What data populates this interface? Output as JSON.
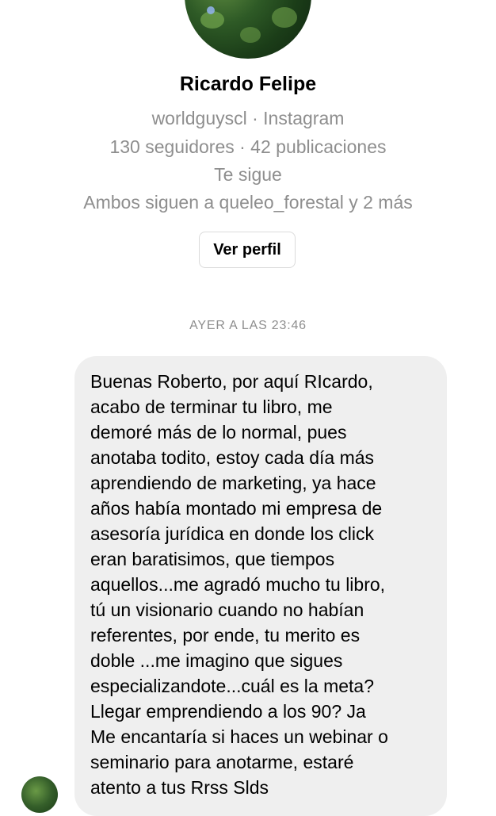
{
  "profile": {
    "name": "Ricardo Felipe",
    "handle_line": "worldguyscl · Instagram",
    "stats_line": "130 seguidores · 42 publicaciones",
    "follows_you": "Te sigue",
    "mutual_line": "Ambos siguen a queleo_forestal y 2 más",
    "view_profile_label": "Ver perfil"
  },
  "thread": {
    "timestamp": "AYER A LAS 23:46",
    "message_lines": [
      "Buenas Roberto, por aquí RIcardo,",
      "acabo de terminar tu libro, me",
      "demoré más de lo normal, pues",
      "anotaba todito, estoy cada día más",
      "aprendiendo de marketing, ya hace",
      "años había montado mi empresa de",
      "asesoría jurídica en donde los click",
      "eran baratisimos, que tiempos",
      "aquellos...me agradó mucho tu libro,",
      "tú un visionario cuando no habían",
      "referentes, por ende, tu merito es",
      "doble ...me imagino que sigues",
      "especializandote...cuál es la meta?",
      "Llegar emprendiendo a los 90? Ja",
      "Me encantaría si haces un webinar o",
      "seminario para anotarme, estaré",
      "atento a tus Rrss Slds"
    ]
  }
}
